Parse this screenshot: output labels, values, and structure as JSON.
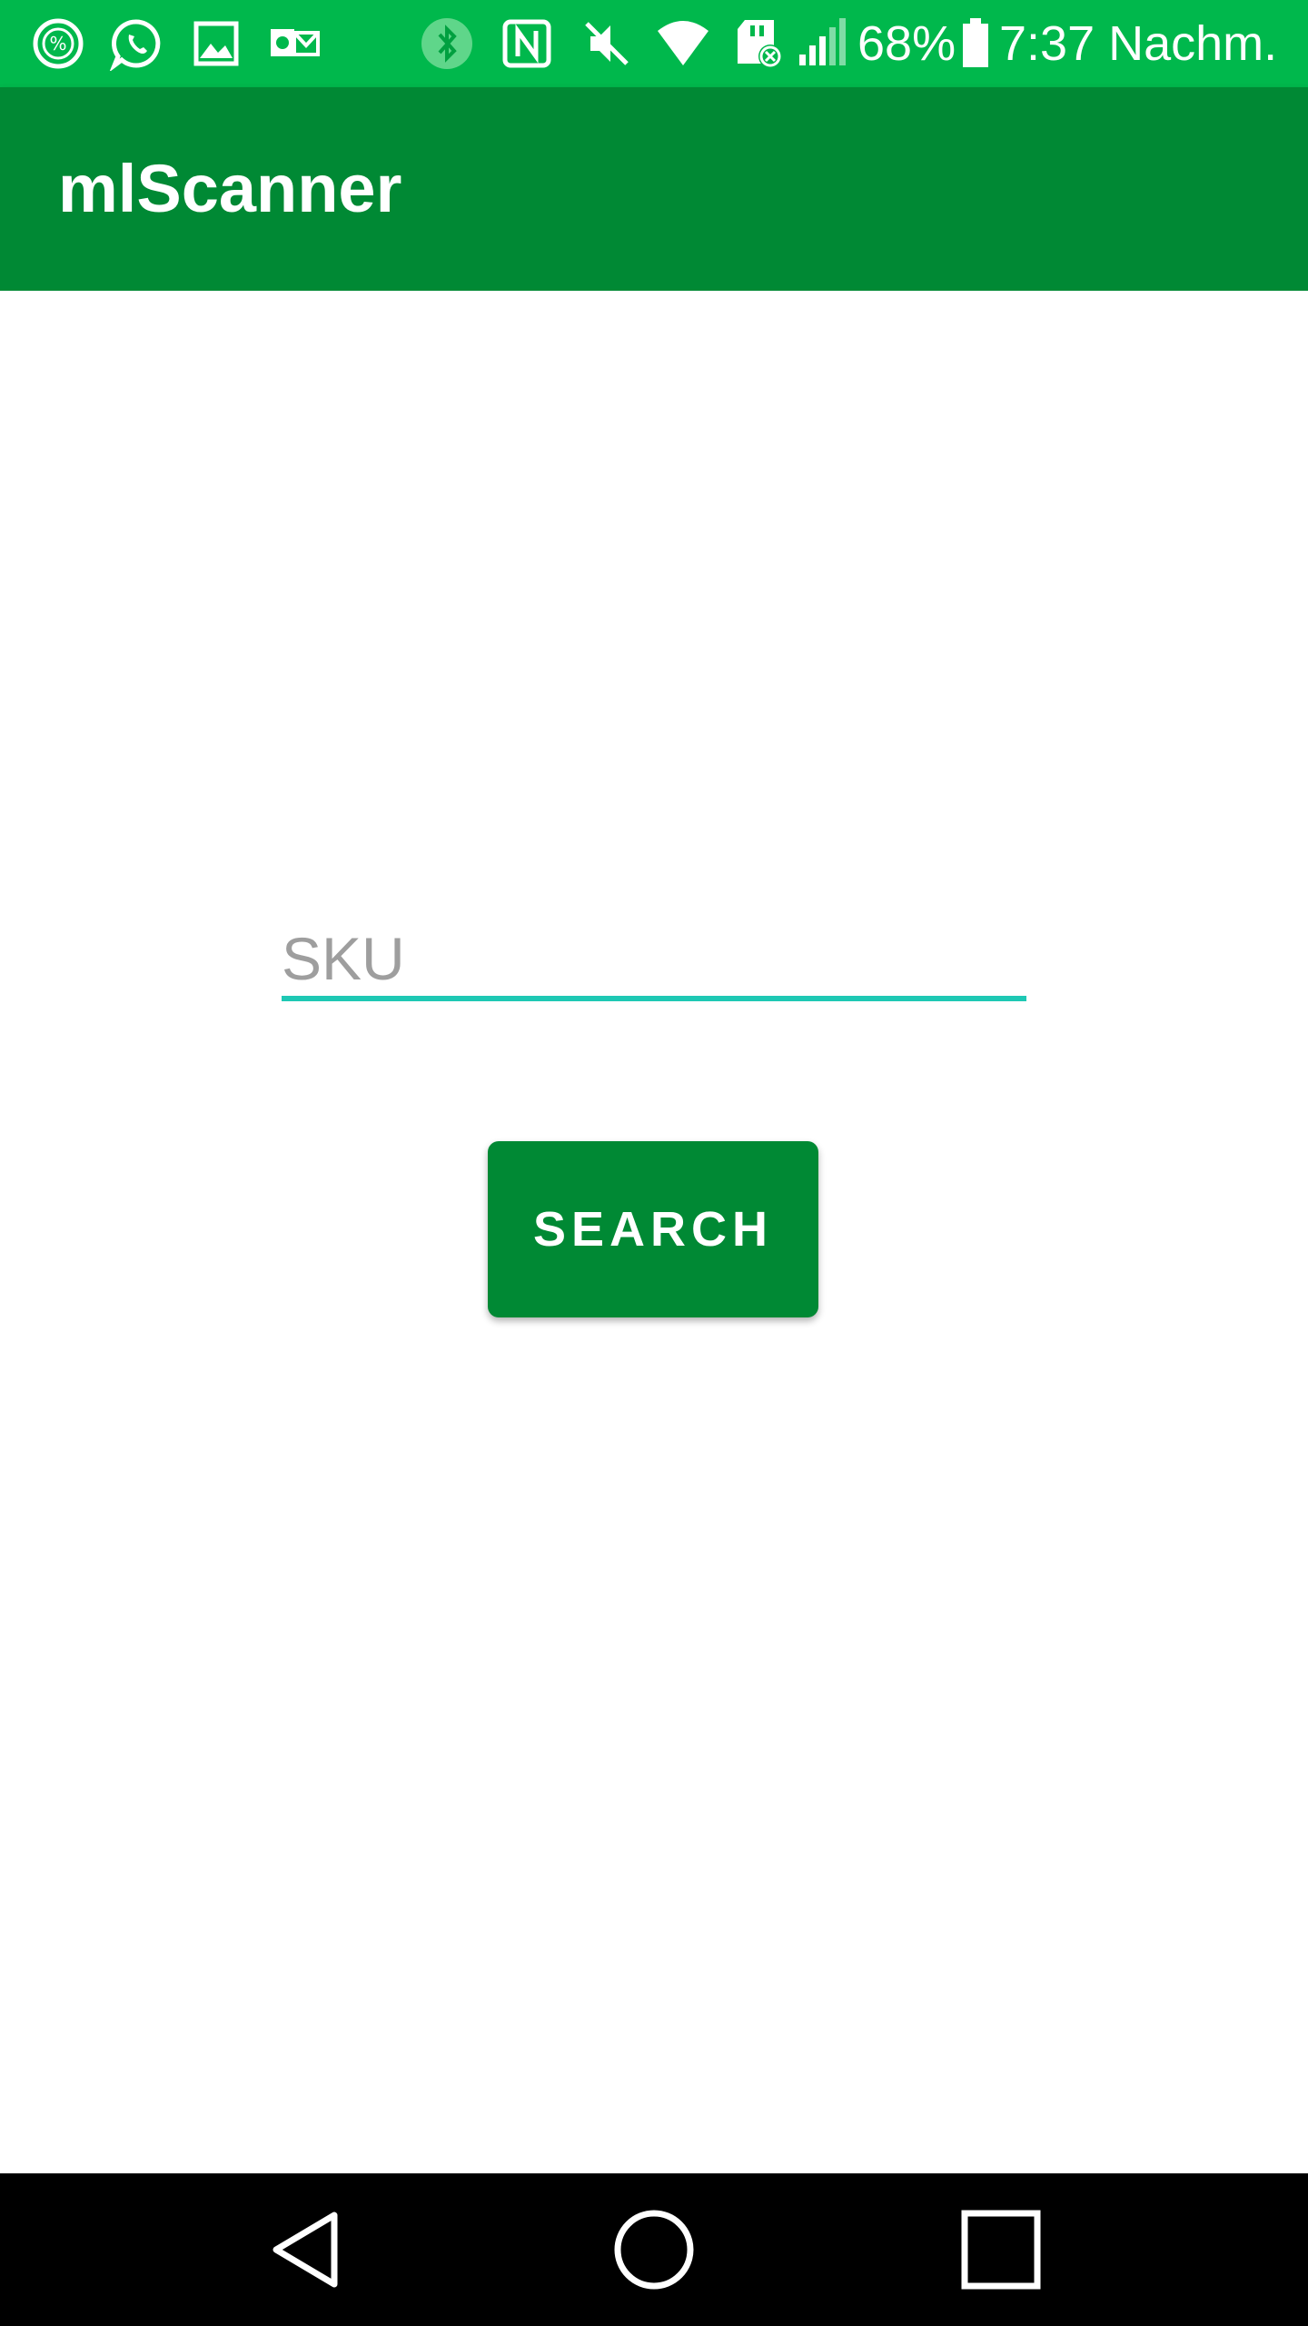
{
  "status_bar": {
    "battery_percent": "68%",
    "time": "7:37 Nachm.",
    "background_color": "#00b84c",
    "icons": [
      "percent-app-icon",
      "whatsapp-icon",
      "gallery-icon",
      "outlook-icon",
      "bluetooth-icon",
      "nfc-icon",
      "mute-icon",
      "wifi-icon",
      "sd-card-icon",
      "signal-icon",
      "battery-icon"
    ]
  },
  "app_bar": {
    "title": "mlScanner",
    "background_color": "#008934"
  },
  "form": {
    "sku_placeholder": "SKU",
    "sku_value": "",
    "search_label": "SEARCH",
    "accent_color": "#1ec8b4"
  },
  "nav_bar": {
    "icons": [
      "back-icon",
      "home-icon",
      "recents-icon"
    ]
  }
}
